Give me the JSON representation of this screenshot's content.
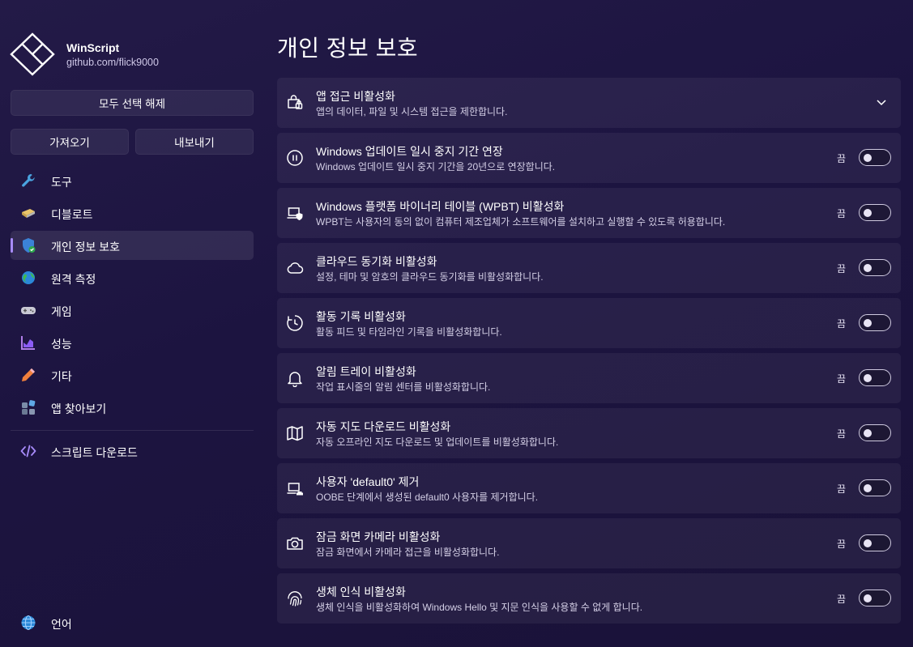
{
  "brand": {
    "name": "WinScript",
    "subtitle": "github.com/flick9000"
  },
  "sidebar": {
    "deselect_all": "모두 선택 해제",
    "import": "가져오기",
    "export": "내보내기",
    "items": [
      {
        "label": "도구",
        "icon": "wrench-icon"
      },
      {
        "label": "디블로트",
        "icon": "broom-icon"
      },
      {
        "label": "개인 정보 보호",
        "icon": "shield-icon",
        "active": true
      },
      {
        "label": "원격 측정",
        "icon": "globe-telemetry-icon"
      },
      {
        "label": "게임",
        "icon": "gamepad-icon"
      },
      {
        "label": "성능",
        "icon": "chart-icon"
      },
      {
        "label": "기타",
        "icon": "pencil-icon"
      },
      {
        "label": "앱 찾아보기",
        "icon": "apps-icon"
      }
    ],
    "download_script": "스크립트 다운로드",
    "language": "언어"
  },
  "page": {
    "title": "개인 정보 보호"
  },
  "settings": [
    {
      "title": "앱 접근 비활성화",
      "desc": "앱의 데이터, 파일 및 시스템 접근을 제한합니다.",
      "icon": "lock-bag-icon",
      "expandable": true
    },
    {
      "title": "Windows 업데이트 일시 중지 기간 연장",
      "desc": "Windows 업데이트 일시 중지 기간을 20년으로 연장합니다.",
      "icon": "pause-icon",
      "state": "끔",
      "on": false
    },
    {
      "title": "Windows 플랫폼 바이너리 테이블 (WPBT) 비활성화",
      "desc": "WPBT는 사용자의 동의 없이 컴퓨터 제조업체가 소프트웨어를 설치하고 실행할 수 있도록 허용합니다.",
      "icon": "laptop-shield-icon",
      "state": "끔",
      "on": false
    },
    {
      "title": "클라우드 동기화 비활성화",
      "desc": "설정, 테마 및 암호의 클라우드 동기화를 비활성화합니다.",
      "icon": "cloud-icon",
      "state": "끔",
      "on": false
    },
    {
      "title": "활동 기록 비활성화",
      "desc": "활동 피드 및 타임라인 기록을 비활성화합니다.",
      "icon": "history-icon",
      "state": "끔",
      "on": false
    },
    {
      "title": "알림 트레이 비활성화",
      "desc": "작업 표시줄의 알림 센터를 비활성화합니다.",
      "icon": "bell-icon",
      "state": "끔",
      "on": false
    },
    {
      "title": "자동 지도 다운로드 비활성화",
      "desc": "자동 오프라인 지도 다운로드 및 업데이트를 비활성화합니다.",
      "icon": "map-icon",
      "state": "끔",
      "on": false
    },
    {
      "title": "사용자 'default0' 제거",
      "desc": "OOBE 단계에서 생성된 default0 사용자를 제거합니다.",
      "icon": "user-laptop-icon",
      "state": "끔",
      "on": false
    },
    {
      "title": "잠금 화면 카메라 비활성화",
      "desc": "잠금 화면에서 카메라 접근을 비활성화합니다.",
      "icon": "camera-icon",
      "state": "끔",
      "on": false
    },
    {
      "title": "생체 인식 비활성화",
      "desc": "생체 인식을 비활성화하여 Windows Hello 및 지문 인식을 사용할 수 없게 합니다.",
      "icon": "fingerprint-icon",
      "state": "끔",
      "on": false
    }
  ]
}
